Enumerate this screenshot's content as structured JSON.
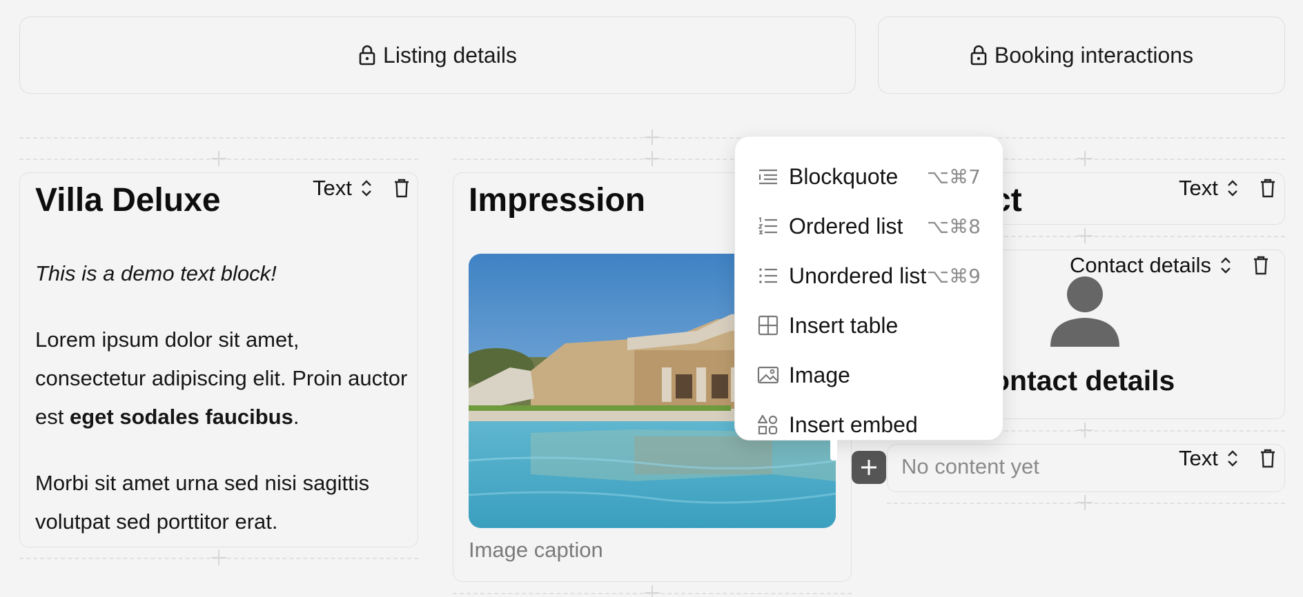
{
  "locked_sections": [
    {
      "label": "Listing details"
    },
    {
      "label": "Booking interactions"
    }
  ],
  "text_block": {
    "type_label": "Text",
    "title": "Villa Deluxe",
    "intro": "This is a demo text block!",
    "para1_start": "Lorem ipsum dolor sit amet, consectetur adipiscing elit. Proin auctor est ",
    "para1_bold": "eget sodales faucibus",
    "para1_end": ".",
    "para2": "Morbi sit amet urna sed nisi sagittis volutpat sed porttitor erat."
  },
  "impression_block": {
    "title": "Impression",
    "caption_placeholder": "Image caption"
  },
  "contact_title_block": {
    "type_label": "Text",
    "title_visible": "ct"
  },
  "contact_block": {
    "type_label": "Contact details",
    "name": "Contact details",
    "name_visible": "ontact details"
  },
  "empty_text_block": {
    "type_label": "Text",
    "placeholder": "No content yet"
  },
  "insert_menu": {
    "items": [
      {
        "label": "Blockquote",
        "shortcut": "⌥⌘7",
        "icon": "blockquote-icon"
      },
      {
        "label": "Ordered list",
        "shortcut": "⌥⌘8",
        "icon": "ordered-list-icon"
      },
      {
        "label": "Unordered list",
        "shortcut": "⌥⌘9",
        "icon": "unordered-list-icon"
      },
      {
        "label": "Insert table",
        "shortcut": "",
        "icon": "table-icon"
      },
      {
        "label": "Image",
        "shortcut": "",
        "icon": "image-icon"
      },
      {
        "label": "Insert embed",
        "shortcut": "",
        "icon": "embed-icon"
      }
    ]
  }
}
